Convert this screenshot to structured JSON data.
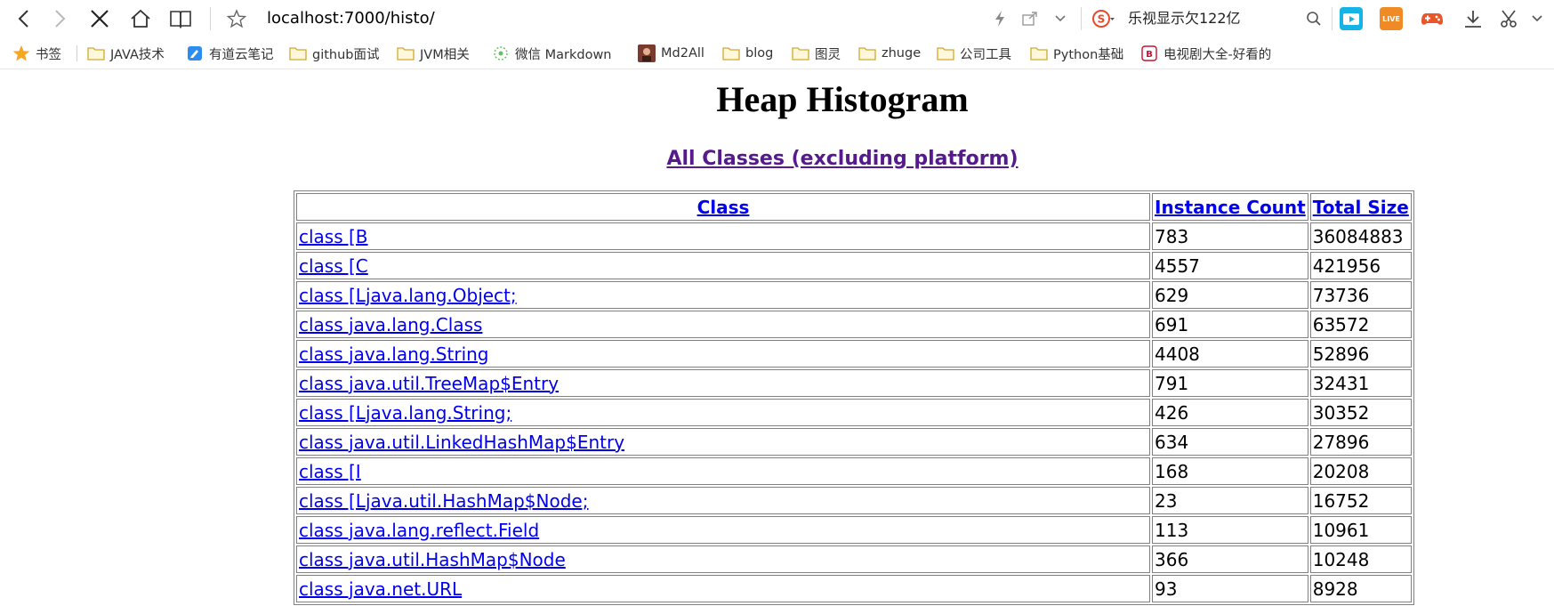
{
  "browser": {
    "url_host": "localhost",
    "url_rest": ":7000/histo/",
    "search_text": "乐视显示欠122亿",
    "app_icons": {
      "live_label": "LIVE"
    }
  },
  "bookmarks": [
    {
      "label": "书签",
      "icon": "star-icon"
    },
    {
      "label": "JAVA技术",
      "icon": "folder-icon"
    },
    {
      "label": "有道云笔记",
      "icon": "note-icon"
    },
    {
      "label": "github面试",
      "icon": "folder-icon"
    },
    {
      "label": "JVM相关",
      "icon": "folder-icon"
    },
    {
      "label": "微信 Markdown",
      "icon": "wechat-markdown-icon"
    },
    {
      "label": "Md2All",
      "icon": "md2all-icon"
    },
    {
      "label": "blog",
      "icon": "folder-icon"
    },
    {
      "label": "图灵",
      "icon": "folder-icon"
    },
    {
      "label": "zhuge",
      "icon": "folder-icon"
    },
    {
      "label": "公司工具",
      "icon": "folder-icon"
    },
    {
      "label": "Python基础",
      "icon": "folder-icon"
    },
    {
      "label": "电视剧大全-好看的",
      "icon": "tv-icon"
    }
  ],
  "page": {
    "title": "Heap Histogram",
    "all_classes_link": "All Classes (excluding platform)"
  },
  "table": {
    "headers": [
      "Class",
      "Instance Count",
      "Total Size"
    ],
    "rows": [
      {
        "cls": "class [B",
        "count": "783",
        "size": "36084883"
      },
      {
        "cls": "class [C",
        "count": "4557",
        "size": "421956"
      },
      {
        "cls": "class [Ljava.lang.Object;",
        "count": "629",
        "size": "73736"
      },
      {
        "cls": "class java.lang.Class",
        "count": "691",
        "size": "63572"
      },
      {
        "cls": "class java.lang.String",
        "count": "4408",
        "size": "52896"
      },
      {
        "cls": "class java.util.TreeMap$Entry",
        "count": "791",
        "size": "32431"
      },
      {
        "cls": "class [Ljava.lang.String;",
        "count": "426",
        "size": "30352"
      },
      {
        "cls": "class java.util.LinkedHashMap$Entry",
        "count": "634",
        "size": "27896"
      },
      {
        "cls": "class [I",
        "count": "168",
        "size": "20208"
      },
      {
        "cls": "class [Ljava.util.HashMap$Node;",
        "count": "23",
        "size": "16752"
      },
      {
        "cls": "class java.lang.reflect.Field",
        "count": "113",
        "size": "10961"
      },
      {
        "cls": "class java.util.HashMap$Node",
        "count": "366",
        "size": "10248"
      },
      {
        "cls": "class java.net.URL",
        "count": "93",
        "size": "8928"
      }
    ]
  }
}
